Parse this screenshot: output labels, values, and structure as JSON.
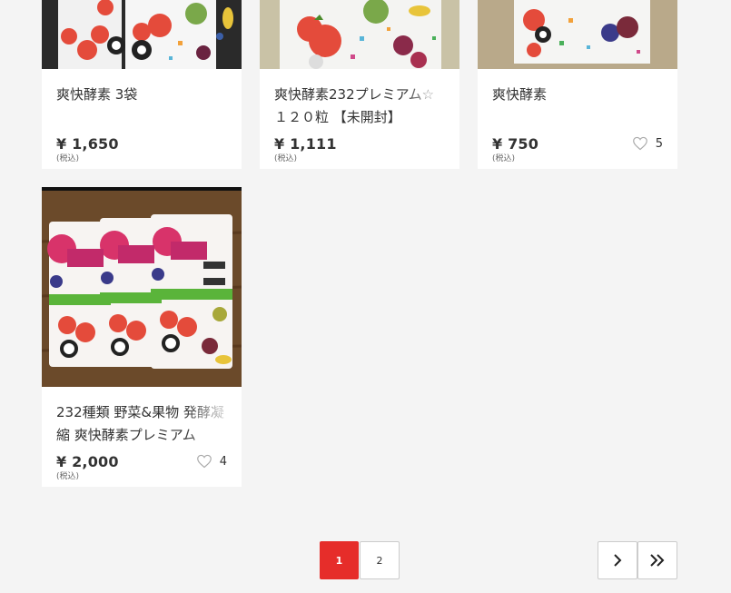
{
  "products": [
    {
      "title": "爽快酵素 3袋",
      "price": "¥ 1,650",
      "tax": "(税込)"
    },
    {
      "title": "爽快酵素232プレミアム☆ １２０粒 【未開封】",
      "price": "¥ 1,111",
      "tax": "(税込)"
    },
    {
      "title": "爽快酵素",
      "price": "¥ 750",
      "tax": "(税込)",
      "likes": "5"
    },
    {
      "title": "232種類 野菜&果物 発酵凝縮 爽快酵素プレミアム",
      "price": "¥ 2,000",
      "tax": "(税込)",
      "likes": "4"
    }
  ],
  "pagination": {
    "pages": [
      "1",
      "2"
    ],
    "current_page": "1",
    "next_icon": "chevron-right-icon",
    "last_icon": "double-chevron-right-icon"
  },
  "colors": {
    "accent": "#e62d2a",
    "background": "#f4f4f4"
  }
}
